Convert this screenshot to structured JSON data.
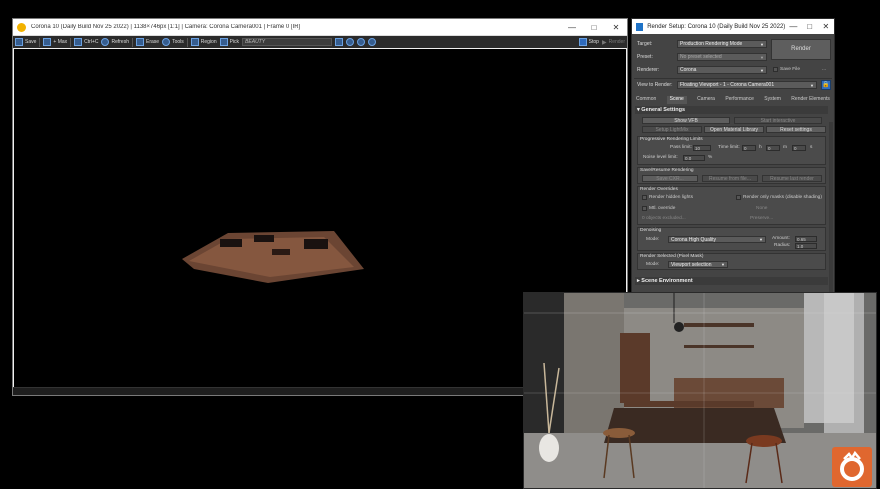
{
  "vfb": {
    "title": "Corona 10 (Daily Build Nov 25 2022) | 1138×746px [1:1] | Camera: Corona Camera001 | Frame 0 [IR]",
    "window_buttons": [
      "—",
      "□",
      "✕"
    ],
    "toolbar": {
      "save": "Save",
      "max": "+ Max",
      "ctrl_c": "Ctrl+C",
      "refresh": "Refresh",
      "erase": "Erase",
      "tools": "Tools",
      "region": "Region",
      "pick": "Pick",
      "beauty": "BEAUTY",
      "stop": "Stop",
      "render": "Render"
    }
  },
  "render_setup": {
    "title": "Render Setup: Corona 10 (Daily Build Nov 25 2022)",
    "window_buttons": [
      "—",
      "□",
      "✕"
    ],
    "target_label": "Target:",
    "target_value": "Production Rendering Mode",
    "preset_label": "Preset:",
    "preset_value": "No preset selected",
    "renderer_label": "Renderer:",
    "renderer_value": "Corona",
    "render_button": "Render",
    "save_file": "Save File",
    "save_file_more": "...",
    "view_label": "View to Render:",
    "view_value": "Floating Viewport - 1 - Corona Camera001",
    "tabs": [
      "Common",
      "Scene",
      "Camera",
      "Performance",
      "System",
      "Render Elements"
    ],
    "active_tab": "Scene",
    "general_settings": "General Settings",
    "show_vfb": "Show VFB",
    "start_interactive": "Start interactive",
    "setup_lightmix": "Setup LightMix",
    "open_material_library": "Open Material Library",
    "reset_settings": "Reset settings",
    "progressive_limits": "Progressive Rendering Limits",
    "pass_limit_label": "Pass limit:",
    "pass_limit_value": "10",
    "time_limit_label": "Time limit:",
    "time_h": "0",
    "time_h_unit": "h",
    "time_m": "0",
    "time_m_unit": "m",
    "time_s": "0",
    "time_s_unit": "s",
    "noise_label": "Noise level limit:",
    "noise_value": "0.0",
    "noise_unit": "%",
    "save_resume": "Save/Resume Rendering",
    "save_cxr": "Save CXR...",
    "resume_from_file": "Resume from file...",
    "resume_last": "Resume last render",
    "render_overrides": "Render Overrides",
    "render_hidden_lights": "Render hidden lights",
    "render_only_masks": "Render only masks (disable shading)",
    "mtl_override": "Mtl. override",
    "none": "None",
    "objects_excluded": "0 objects excluded...",
    "preserve": "Preserve...",
    "denoising": "Denoising",
    "mode_label": "Mode:",
    "denoise_mode": "Corona High Quality",
    "amount_label": "Amount:",
    "amount_value": "0.65",
    "radius_label": "Radius:",
    "radius_value": "1.0",
    "render_selected": "Render Selected (Pixel Mask)",
    "mode2_label": "Mode:",
    "render_selected_mode": "Viewport selection",
    "scene_environment": "Scene Environment"
  }
}
